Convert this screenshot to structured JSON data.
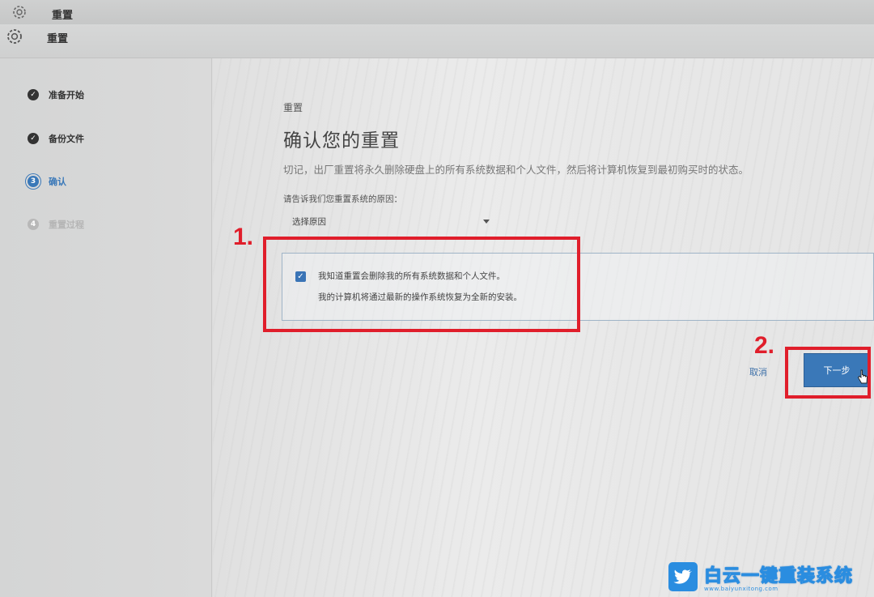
{
  "window": {
    "title": "重置",
    "icon": "gear-icon"
  },
  "sidebar": {
    "steps": [
      {
        "number": "✓",
        "label": "准备开始",
        "state": "done"
      },
      {
        "number": "✓",
        "label": "备份文件",
        "state": "done"
      },
      {
        "number": "3",
        "label": "确认",
        "state": "current"
      },
      {
        "number": "4",
        "label": "重置过程",
        "state": "pending"
      }
    ]
  },
  "main": {
    "breadcrumb": "重置",
    "heading": "确认您的重置",
    "warning": "切记，出厂重置将永久删除硬盘上的所有系统数据和个人文件，然后将计算机恢复到最初购买时的状态。",
    "reason_label": "请告诉我们您重置系统的原因：",
    "reason_select": {
      "value": "选择原因"
    },
    "acknowledge": {
      "checked": true,
      "line1": "我知道重置会删除我的所有系统数据和个人文件。",
      "line2": "我的计算机将通过最新的操作系统恢复为全新的安装。"
    },
    "cancel_label": "取消",
    "next_label": "下一步"
  },
  "annotations": {
    "step1": "1.",
    "step2": "2.",
    "color": "#e01e2b"
  },
  "watermark": {
    "title": "白云一键重装系统",
    "subtitle": "www.baiyunxitong.com"
  },
  "colors": {
    "accent": "#3a78b8",
    "done_step": "#333333",
    "current_step": "#3a78b8",
    "pending_step": "#b8b8b8"
  }
}
